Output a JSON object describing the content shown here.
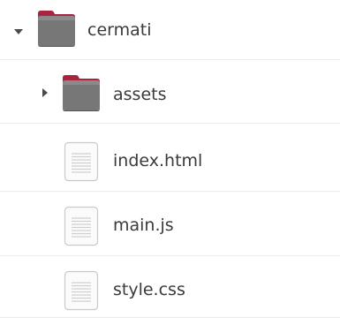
{
  "tree": {
    "root": {
      "name": "cermati",
      "expanded": true,
      "icon": "folder-icon"
    },
    "children": [
      {
        "name": "assets",
        "kind": "folder",
        "expanded": false,
        "icon": "folder-icon"
      },
      {
        "name": "index.html",
        "kind": "file",
        "icon": "text-file-icon"
      },
      {
        "name": "main.js",
        "kind": "file",
        "icon": "text-file-icon"
      },
      {
        "name": "style.css",
        "kind": "file",
        "icon": "text-file-icon"
      }
    ]
  },
  "colors": {
    "folder_tab": "#a8243f",
    "folder_body": "#6e6e6e",
    "separator": "#ebebeb",
    "text": "#3a3a3a"
  }
}
